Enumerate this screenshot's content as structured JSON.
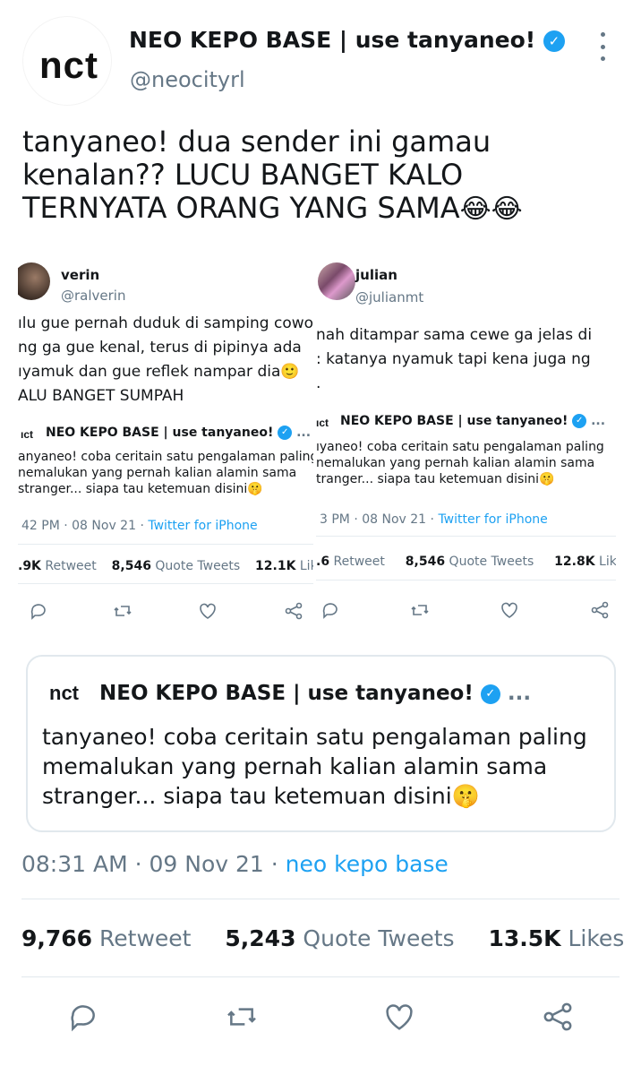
{
  "header": {
    "display_name": "NEO KEPO BASE | use tanyaneo!",
    "handle": "@neocityrl",
    "avatar_text": "nct"
  },
  "tweet": {
    "line1": "tanyaneo! dua sender ini gamau",
    "line2": "kenalan?? LUCU BANGET KALO",
    "line3": "TERNYATA ORANG YANG SAMA",
    "emoji": "😂😂"
  },
  "screenshot_left": {
    "name": "verin",
    "handle": "@ralverin",
    "lines": [
      "ılu gue pernah duduk di samping cowo",
      "ng ga gue kenal, terus di pipinya ada",
      "ıyamuk dan gue reflek nampar dia🙂",
      "ALU BANGET SUMPAH"
    ],
    "quote_logo": "ıct",
    "quote_name": "NEO KEPO BASE | use tanyaneo!",
    "quote_more": "...",
    "quote_lines": [
      "anyaneo! coba ceritain satu pengalaman paling",
      "nemalukan yang pernah kalian alamin sama",
      "stranger... siapa tau ketemuan disini🤫"
    ],
    "time": "42 PM · 08 Nov 21 · ",
    "source": "Twitter for iPhone",
    "retweets": ".9K",
    "retweet_label": "Retweet",
    "quotes": "8,546",
    "quotes_label": "Quote Tweets",
    "likes": "12.1K",
    "likes_label": "Likes"
  },
  "screenshot_right": {
    "name": "julian",
    "handle": "@julianmt",
    "lines": [
      "nah ditampar sama cewe ga jelas di",
      ": katanya nyamuk tapi kena juga ng",
      "."
    ],
    "quote_logo": "ıct",
    "quote_name": "NEO KEPO BASE | use tanyaneo!",
    "quote_more": "...",
    "quote_lines": [
      "ıyaneo! coba ceritain satu pengalaman paling",
      "nemalukan yang pernah kalian alamin sama",
      "tranger... siapa tau ketemuan disini🤫"
    ],
    "time": "3 PM · 08 Nov 21 · ",
    "source": "Twitter for iPhone",
    "retweets": ".6",
    "retweet_label": "Retweet",
    "quotes": "8,546",
    "quotes_label": "Quote Tweets",
    "likes": "12.8K",
    "likes_label": "Like:"
  },
  "quoted_tweet": {
    "logo": "nct",
    "name": "NEO KEPO BASE | use tanyaneo!",
    "more": "...",
    "line1": "tanyaneo! coba ceritain satu pengalaman paling",
    "line2": "memalukan yang pernah kalian alamin sama",
    "line3": "stranger... siapa tau ketemuan disini",
    "emoji": "🤫"
  },
  "meta": {
    "time": "08:31 AM · 09 Nov 21 · ",
    "source": "neo kepo base"
  },
  "stats": {
    "retweets": "9,766",
    "retweet_label": "Retweet",
    "quotes": "5,243",
    "quotes_label": "Quote Tweets",
    "likes": "13.5K",
    "likes_label": "Likes"
  },
  "colors": {
    "accent": "#1da1f2",
    "muted": "#657786",
    "text": "#14171a"
  },
  "icons": [
    "reply-icon",
    "retweet-icon",
    "like-icon",
    "share-icon",
    "verified-icon",
    "more-icon"
  ]
}
